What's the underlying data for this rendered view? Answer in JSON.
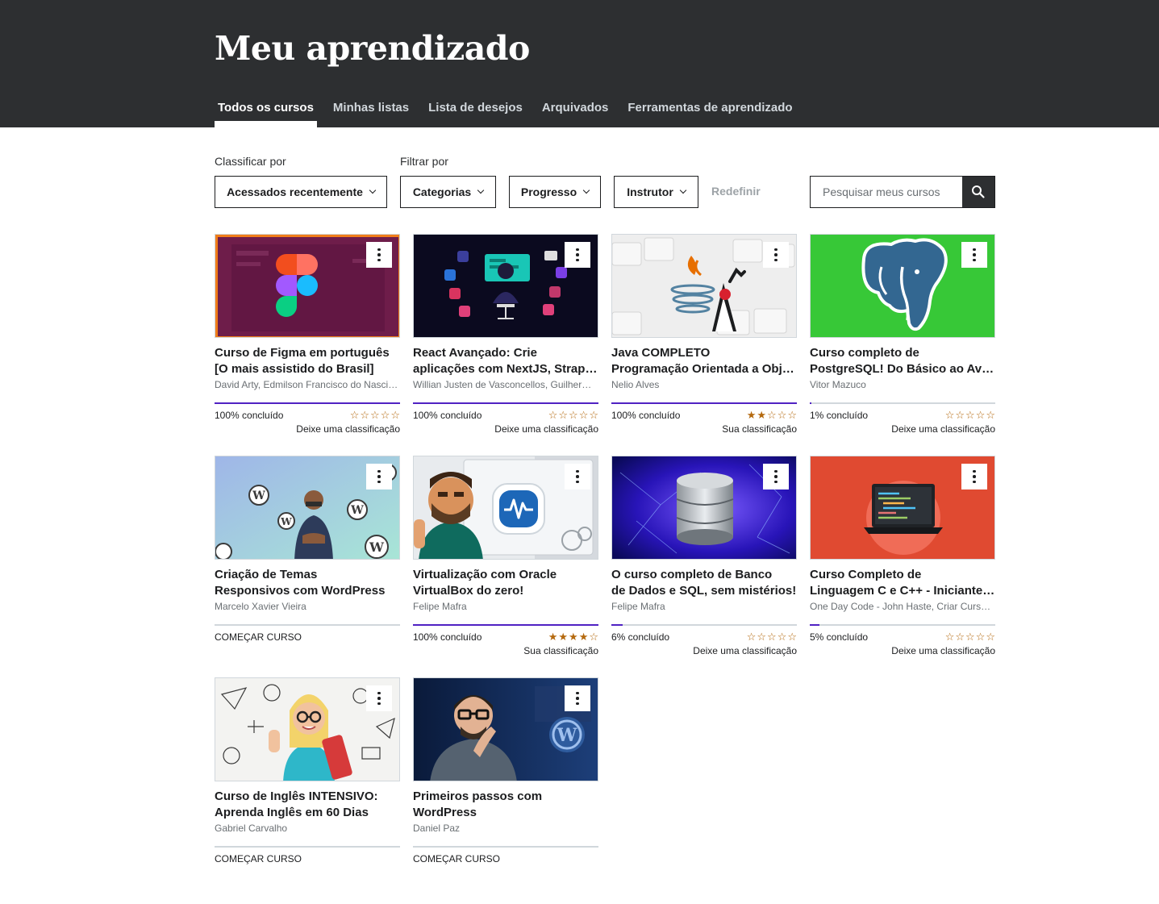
{
  "header": {
    "title": "Meu aprendizado",
    "tabs": [
      "Todos os cursos",
      "Minhas listas",
      "Lista de desejos",
      "Arquivados",
      "Ferramentas de aprendizado"
    ]
  },
  "toolbar": {
    "sort_label": "Classificar por",
    "filter_label": "Filtrar por",
    "sort_value": "Acessados recentemente",
    "filters": [
      "Categorias",
      "Progresso",
      "Instrutor"
    ],
    "reset": "Redefinir",
    "search_placeholder": "Pesquisar meus cursos"
  },
  "colors": {
    "header_bg": "#2d2f31",
    "progress": "#5022c3",
    "star": "#b4690e"
  },
  "courses": [
    {
      "title1": "Curso de Figma em português",
      "title2": "[O mais assistido do Brasil]",
      "instructor": "David Arty, Edmilson Francisco do Nascimento",
      "status": "100% concluído",
      "progress": 100,
      "rating": 0,
      "rating_label": "Deixe uma classificação",
      "thumb": "figma-logo"
    },
    {
      "title1": "React Avançado: Crie",
      "title2": "aplicações com NextJS, Strapi e mais",
      "instructor": "Willian Justen de Vasconcellos, Guilherme Louro",
      "status": "100% concluído",
      "progress": 100,
      "rating": 0,
      "rating_label": "Deixe uma classificação",
      "thumb": "react-dev"
    },
    {
      "title1": "Java COMPLETO",
      "title2": "Programação Orientada a Objetos + Projetos",
      "instructor": "Nelio Alves",
      "status": "100% concluído",
      "progress": 100,
      "rating": 2,
      "rating_label": "Sua classificação",
      "thumb": "java-duke"
    },
    {
      "title1": "Curso completo de",
      "title2": "PostgreSQL! Do Básico ao Avançado",
      "instructor": "Vitor Mazuco",
      "status": "1% concluído",
      "progress": 1,
      "rating": 0,
      "rating_label": "Deixe uma classificação",
      "thumb": "postgres-elephant"
    },
    {
      "title1": "Criação de Temas",
      "title2": "Responsivos com WordPress",
      "instructor": "Marcelo Xavier Vieira",
      "status": "COMEÇAR CURSO",
      "progress": 0,
      "rating": null,
      "rating_label": "",
      "thumb": "wordpress-man"
    },
    {
      "title1": "Virtualização com Oracle",
      "title2": "VirtualBox do zero!",
      "instructor": "Felipe Mafra",
      "status": "100% concluído",
      "progress": 100,
      "rating": 4,
      "rating_label": "Sua classificação",
      "thumb": "virtualbox"
    },
    {
      "title1": "O curso completo de Banco",
      "title2": "de Dados e SQL, sem mistérios!",
      "instructor": "Felipe Mafra",
      "status": "6% concluído",
      "progress": 6,
      "rating": 0,
      "rating_label": "Deixe uma classificação",
      "thumb": "database"
    },
    {
      "title1": "Curso Completo de",
      "title2": "Linguagem C e C++ - Iniciante ao Avançado",
      "instructor": "One Day Code - John Haste, Criar Cursos Online",
      "status": "5% concluído",
      "progress": 5,
      "rating": 0,
      "rating_label": "Deixe uma classificação",
      "thumb": "laptop-code"
    },
    {
      "title1": "Curso de Inglês INTENSIVO:",
      "title2": "Aprenda Inglês em 60 Dias",
      "instructor": "Gabriel Carvalho",
      "status": "COMEÇAR CURSO",
      "progress": 0,
      "rating": null,
      "rating_label": "",
      "thumb": "english-girl"
    },
    {
      "title1": "Primeiros passos com",
      "title2": "WordPress",
      "instructor": "Daniel Paz",
      "status": "COMEÇAR CURSO",
      "progress": 0,
      "rating": null,
      "rating_label": "",
      "thumb": "wordpress-man-blue"
    }
  ]
}
